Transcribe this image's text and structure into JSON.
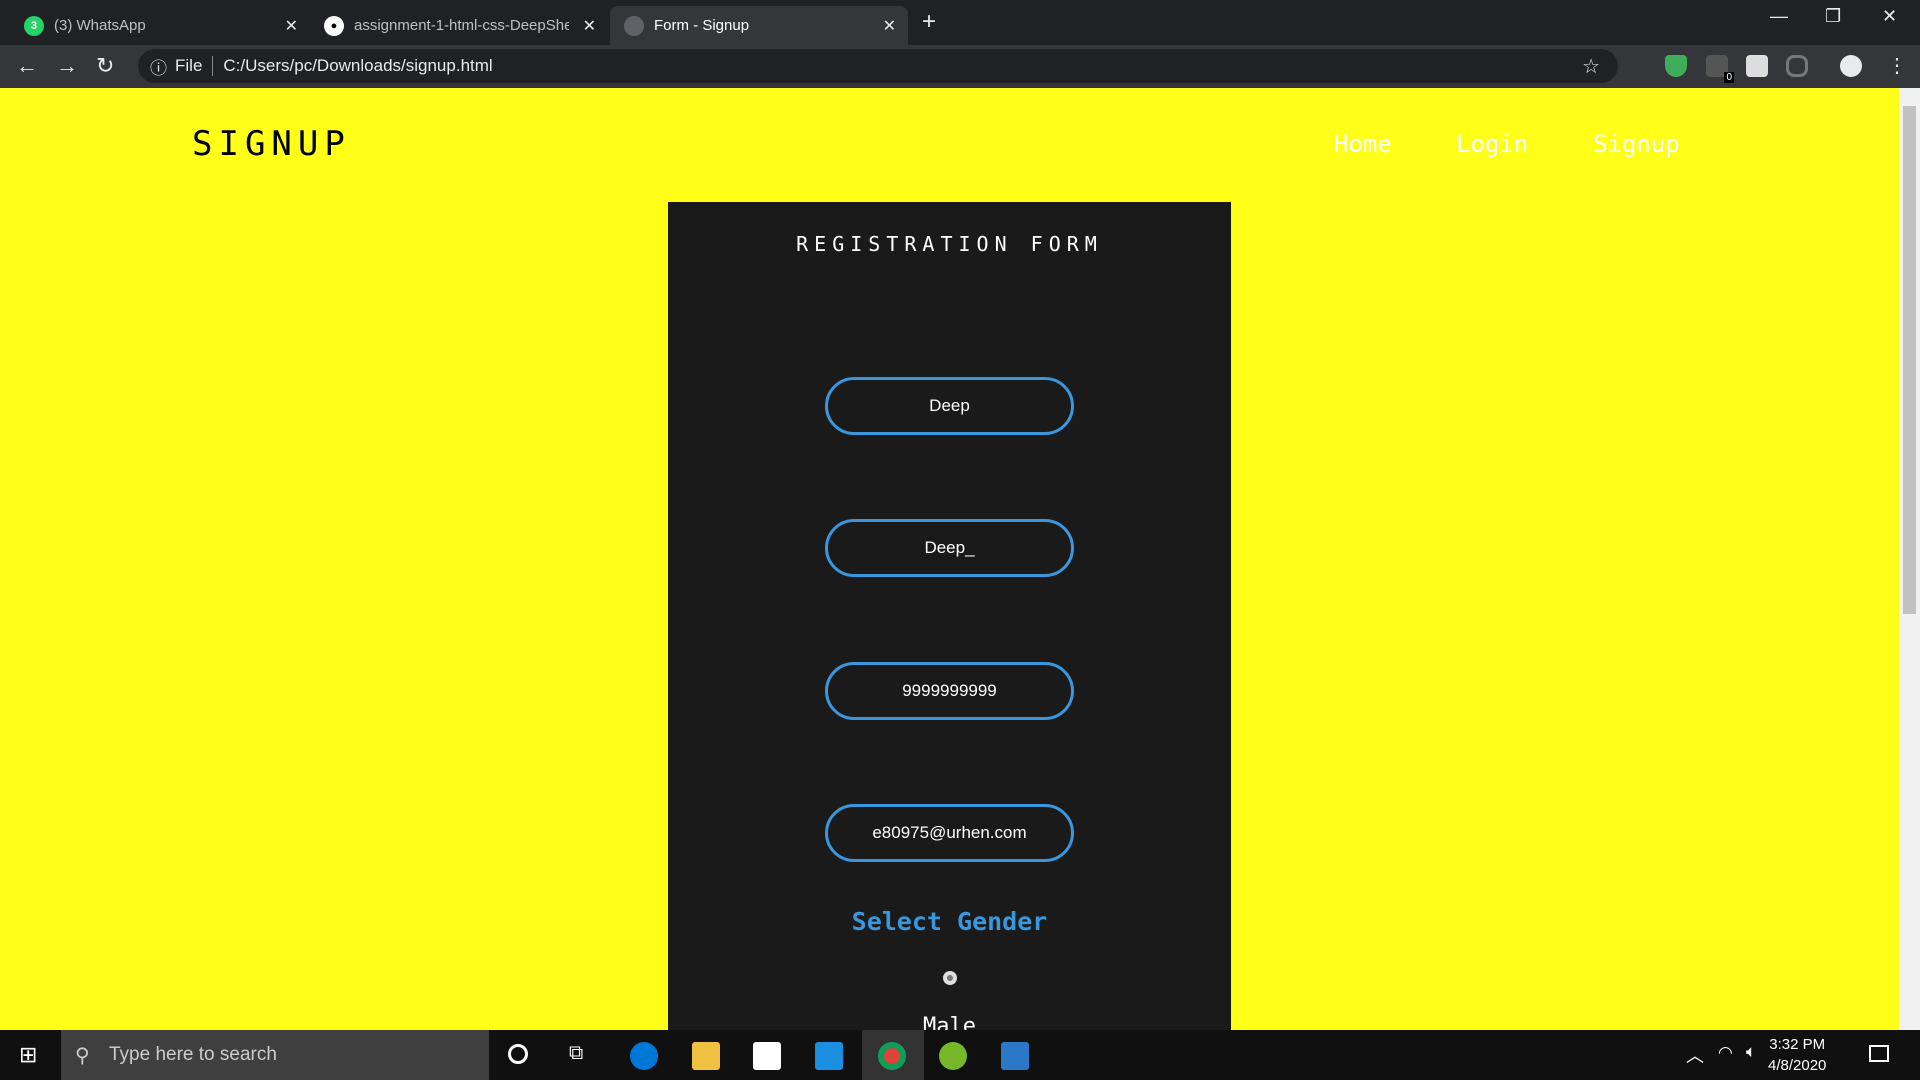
{
  "browser": {
    "tabs": [
      {
        "title": "(3) WhatsApp",
        "icon": "whatsapp-icon",
        "badge": "3",
        "active": false
      },
      {
        "title": "assignment-1-html-css-DeepShe",
        "icon": "github-icon",
        "active": false
      },
      {
        "title": "Form - Signup",
        "icon": "globe-icon",
        "active": true
      }
    ],
    "address": {
      "scheme_label": "File",
      "url": "C:/Users/pc/Downloads/signup.html"
    },
    "extension_badge": "0"
  },
  "page": {
    "logo": "SIGNUP",
    "nav": [
      "Home",
      "Login",
      "Signup"
    ],
    "form": {
      "title": "REGISTRATION FORM",
      "fields": [
        "Deep",
        "Deep_",
        "9999999999",
        "e80975@urhen.com"
      ],
      "gender_label": "Select Gender",
      "gender_option": "Male"
    },
    "colors": {
      "background": "#ffff18",
      "form_bg": "#1a1a1a",
      "accent": "#3a96dd"
    }
  },
  "taskbar": {
    "search_placeholder": "Type here to search",
    "time": "3:32 PM",
    "date": "4/8/2020"
  }
}
